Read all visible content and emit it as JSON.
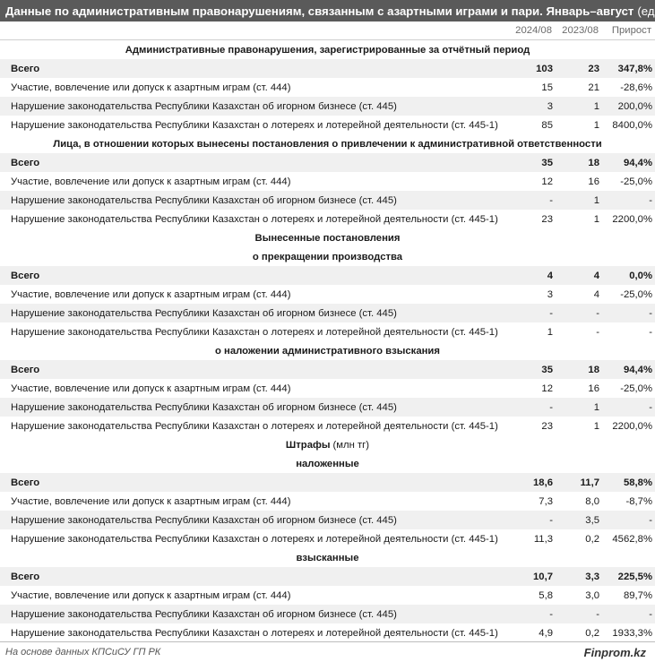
{
  "title": "Данные по административным правонарушениям, связанным с азартными играми и пари. Январь–август",
  "unit": "(ед.)",
  "columns": {
    "y2024": "2024/08",
    "y2023": "2023/08",
    "growth": "Прирост"
  },
  "rows": [
    {
      "type": "section",
      "label": "Административные правонарушения, зарегистрированные за отчётный период"
    },
    {
      "type": "total",
      "label": "Всего",
      "v1": "103",
      "v2": "23",
      "v3": "347,8%"
    },
    {
      "type": "data",
      "label": "Участие, вовлечение или допуск к азартным играм (ст. 444)",
      "v1": "15",
      "v2": "21",
      "v3": "-28,6%"
    },
    {
      "type": "data",
      "label": "Нарушение законодательства Республики Казахстан об игорном бизнесе (ст. 445)",
      "v1": "3",
      "v2": "1",
      "v3": "200,0%"
    },
    {
      "type": "data",
      "label": "Нарушение законодательства Республики Казахстан о лотереях и лотерейной деятельности (ст. 445-1)",
      "v1": "85",
      "v2": "1",
      "v3": "8400,0%"
    },
    {
      "type": "section",
      "label": "Лица, в отношении которых вынесены постановления о привлечении к административной ответственности"
    },
    {
      "type": "total",
      "label": "Всего",
      "v1": "35",
      "v2": "18",
      "v3": "94,4%"
    },
    {
      "type": "data",
      "label": "Участие, вовлечение или допуск к азартным играм (ст. 444)",
      "v1": "12",
      "v2": "16",
      "v3": "-25,0%"
    },
    {
      "type": "data",
      "label": "Нарушение законодательства Республики Казахстан об игорном бизнесе (ст. 445)",
      "v1": "-",
      "v2": "1",
      "v3": "-"
    },
    {
      "type": "data",
      "label": "Нарушение законодательства Республики Казахстан о лотереях и лотерейной деятельности (ст. 445-1)",
      "v1": "23",
      "v2": "1",
      "v3": "2200,0%"
    },
    {
      "type": "section",
      "label": "Вынесенные постановления"
    },
    {
      "type": "section",
      "label": "о прекращении производства"
    },
    {
      "type": "total",
      "label": "Всего",
      "v1": "4",
      "v2": "4",
      "v3": "0,0%"
    },
    {
      "type": "data",
      "label": "Участие, вовлечение или допуск к азартным играм (ст. 444)",
      "v1": "3",
      "v2": "4",
      "v3": "-25,0%"
    },
    {
      "type": "data",
      "label": "Нарушение законодательства Республики Казахстан об игорном бизнесе (ст. 445)",
      "v1": "-",
      "v2": "-",
      "v3": "-"
    },
    {
      "type": "data",
      "label": "Нарушение законодательства Республики Казахстан о лотереях и лотерейной деятельности (ст. 445-1)",
      "v1": "1",
      "v2": "-",
      "v3": "-"
    },
    {
      "type": "section",
      "label": "о наложении административного взыскания"
    },
    {
      "type": "total",
      "label": "Всего",
      "v1": "35",
      "v2": "18",
      "v3": "94,4%"
    },
    {
      "type": "data",
      "label": "Участие, вовлечение или допуск к азартным играм (ст. 444)",
      "v1": "12",
      "v2": "16",
      "v3": "-25,0%"
    },
    {
      "type": "data",
      "label": "Нарушение законодательства Республики Казахстан об игорном бизнесе (ст. 445)",
      "v1": "-",
      "v2": "1",
      "v3": "-"
    },
    {
      "type": "data",
      "label": "Нарушение законодательства Республики Казахстан о лотереях и лотерейной деятельности (ст. 445-1)",
      "v1": "23",
      "v2": "1",
      "v3": "2200,0%"
    },
    {
      "type": "section",
      "label": "Штрафы",
      "sub": "(млн тг)"
    },
    {
      "type": "section",
      "label": "наложенные"
    },
    {
      "type": "total",
      "label": "Всего",
      "v1": "18,6",
      "v2": "11,7",
      "v3": "58,8%"
    },
    {
      "type": "data",
      "label": "Участие, вовлечение или допуск к азартным играм (ст. 444)",
      "v1": "7,3",
      "v2": "8,0",
      "v3": "-8,7%"
    },
    {
      "type": "data",
      "label": "Нарушение законодательства Республики Казахстан об игорном бизнесе (ст. 445)",
      "v1": "-",
      "v2": "3,5",
      "v3": "-"
    },
    {
      "type": "data",
      "label": "Нарушение законодательства Республики Казахстан о лотереях и лотерейной деятельности (ст. 445-1)",
      "v1": "11,3",
      "v2": "0,2",
      "v3": "4562,8%"
    },
    {
      "type": "section",
      "label": "взысканные"
    },
    {
      "type": "total",
      "label": "Всего",
      "v1": "10,7",
      "v2": "3,3",
      "v3": "225,5%"
    },
    {
      "type": "data",
      "label": "Участие, вовлечение или допуск к азартным играм (ст. 444)",
      "v1": "5,8",
      "v2": "3,0",
      "v3": "89,7%"
    },
    {
      "type": "data",
      "label": "Нарушение законодательства Республики Казахстан об игорном бизнесе (ст. 445)",
      "v1": "-",
      "v2": "-",
      "v3": "-"
    },
    {
      "type": "data",
      "label": "Нарушение законодательства Республики Казахстан о лотереях и лотерейной деятельности (ст. 445-1)",
      "v1": "4,9",
      "v2": "0,2",
      "v3": "1933,3%"
    }
  ],
  "footer": {
    "source": "На основе данных КПСиСУ ГП РК",
    "brand": "Finprom.kz"
  },
  "colors": {
    "header_bg": "#5a5a5a",
    "stripe": "#f0f0f0"
  }
}
